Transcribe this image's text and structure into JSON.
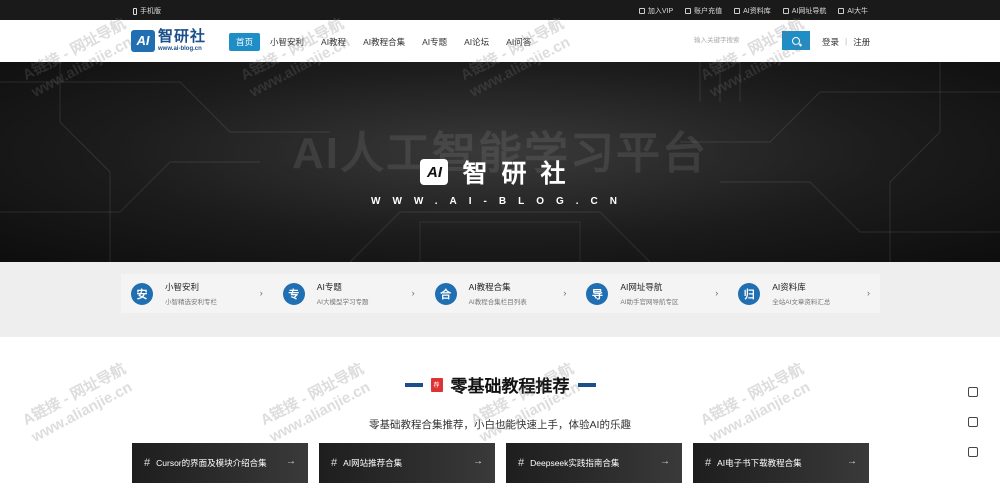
{
  "topbar": {
    "mobile_label": "手机版",
    "links": [
      {
        "icon": "vip-icon",
        "label": "加入VIP"
      },
      {
        "icon": "recharge-icon",
        "label": "账户充值"
      },
      {
        "icon": "folder-icon",
        "label": "AI资料库"
      },
      {
        "icon": "link-icon",
        "label": "AI网址导航"
      },
      {
        "icon": "users-icon",
        "label": "AI大牛"
      }
    ]
  },
  "header": {
    "logo_mark": "AI",
    "logo_name": "智研社",
    "logo_url": "www.ai-blog.cn",
    "nav": [
      {
        "label": "首页",
        "active": true
      },
      {
        "label": "小智安利"
      },
      {
        "label": "AI教程"
      },
      {
        "label": "AI教程合集"
      },
      {
        "label": "AI专题"
      },
      {
        "label": "AI论坛"
      },
      {
        "label": "AI问答"
      }
    ],
    "search_placeholder": "输入关键字搜索",
    "login": "登录",
    "register": "注册"
  },
  "banner": {
    "bg_text": "AI人工智能学习平台",
    "mark": "AI",
    "title": "智研社",
    "url": "WWW.AI-BLOG.CN"
  },
  "features": [
    {
      "icon_char": "安",
      "title": "小智安利",
      "subtitle": "小智精选安利专栏"
    },
    {
      "icon_char": "专",
      "title": "AI专题",
      "subtitle": "AI大模型学习专题"
    },
    {
      "icon_char": "合",
      "title": "AI教程合集",
      "subtitle": "AI教程合集栏目列表"
    },
    {
      "icon_char": "导",
      "title": "AI网址导航",
      "subtitle": "AI助手官网导航专区"
    },
    {
      "icon_char": "归",
      "title": "AI资料库",
      "subtitle": "全站AI文章资料汇总"
    }
  ],
  "section": {
    "badge": "荐",
    "title": "零基础教程推荐",
    "subtitle": "零基础教程合集推荐，小白也能快速上手，体验AI的乐趣",
    "cards": [
      {
        "label": "Cursor的界面及模块介绍合集"
      },
      {
        "label": "AI网站推荐合集"
      },
      {
        "label": "Deepseek实践指南合集"
      },
      {
        "label": "AI电子书下载教程合集"
      }
    ]
  },
  "watermark": {
    "line1": "A链接 - 网址导航",
    "line2": "www.alianjie.cn"
  },
  "colors": {
    "brand": "#1f6fb2",
    "accent": "#1f8dc6",
    "dark": "#1a1a1a"
  }
}
